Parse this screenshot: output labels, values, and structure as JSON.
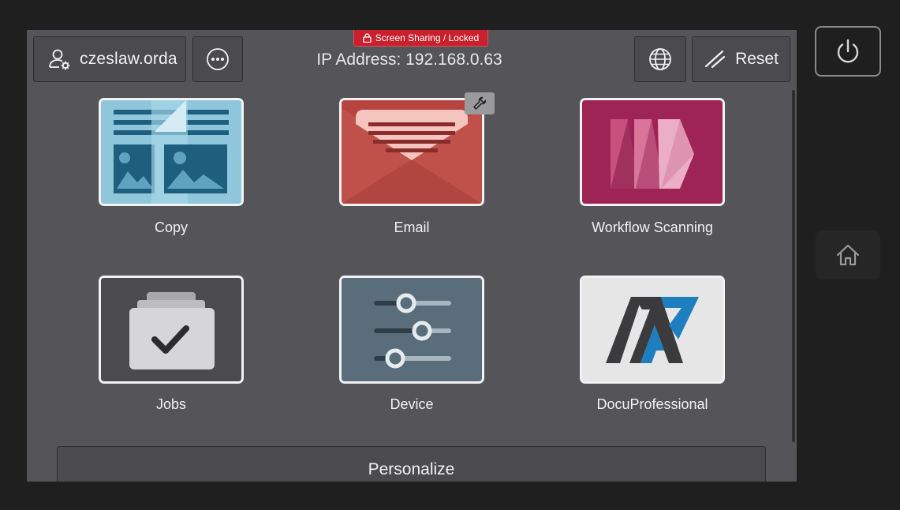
{
  "header": {
    "user_label": "czeslaw.orda",
    "banner_text": "Screen Sharing / Locked",
    "ip_text": "IP Address: 192.168.0.63",
    "reset_label": "Reset"
  },
  "icons": {
    "user": "user-settings-icon",
    "more": "more-options-icon",
    "lock": "lock-icon",
    "globe": "globe-icon",
    "reset": "reset-icon",
    "wrench": "wrench-icon",
    "power": "power-icon",
    "home": "home-icon"
  },
  "apps": [
    {
      "label": "Copy",
      "icon": "copy-icon"
    },
    {
      "label": "Email",
      "icon": "email-icon"
    },
    {
      "label": "Workflow Scanning",
      "icon": "workflow-scanning-icon"
    },
    {
      "label": "Jobs",
      "icon": "jobs-icon"
    },
    {
      "label": "Device",
      "icon": "device-icon"
    },
    {
      "label": "DocuProfessional",
      "icon": "docuprofessional-icon"
    }
  ],
  "footer": {
    "personalize_label": "Personalize"
  },
  "colors": {
    "background": "#1f1f1f",
    "screen": "#545459",
    "banner": "#c8202c",
    "copy_tile": "#8fc6dc",
    "email_tile": "#c0504a",
    "workflow_tile": "#9e2456",
    "jobs_tile": "#4a4a4f",
    "device_tile": "#5a6d7a",
    "docupro_tile": "#e6e6e6"
  }
}
